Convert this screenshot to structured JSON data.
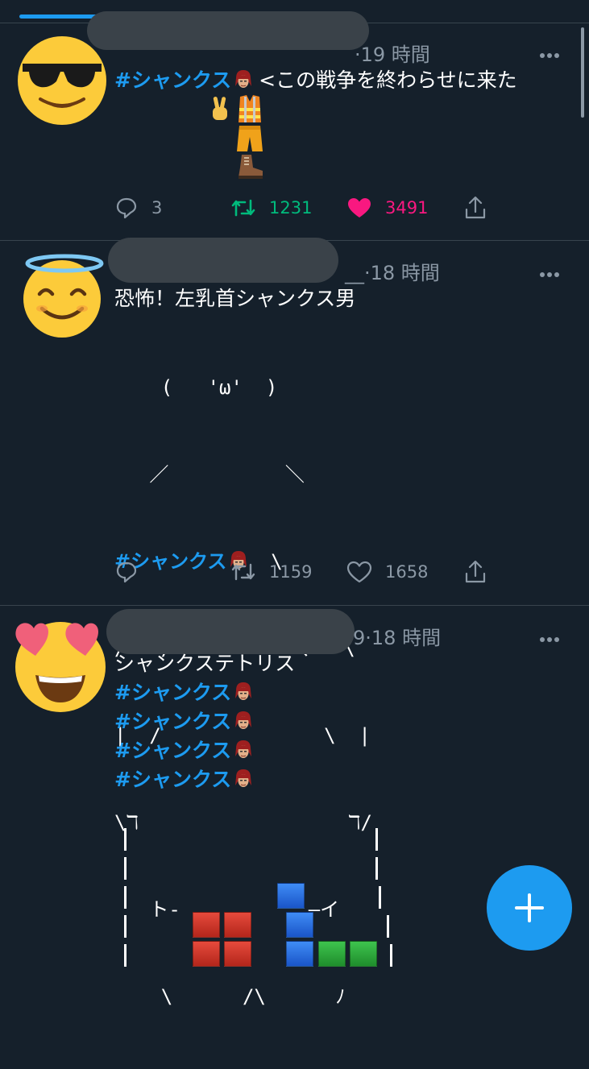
{
  "colors": {
    "background": "#15202b",
    "accent": "#1d9bf0",
    "retweet_active": "#00ba7c",
    "like_active": "#f91880",
    "muted": "#8b98a5"
  },
  "tweets": [
    {
      "time": "·19 時間",
      "tag": "#シャンクス",
      "text_after_tag": " <この戦争を終わらせに来た",
      "emoji_lines": [
        "✌️",
        "🦺",
        "🩳",
        "🥾"
      ],
      "replies": "3",
      "retweets": "1231",
      "likes": "3491",
      "retweeted": true,
      "liked": true,
      "avatar_icon": "sunglasses-face-icon"
    },
    {
      "time": "__·18 時間",
      "text": "恐怖！左乳首シャンクス男",
      "art": [
        "    (   'ω'  )",
        "   ／          ＼",
        "",
        "/   /           、  \\",
        "|  /              \\  |",
        "\\ℸ                  ℸ/",
        "   ト-           ―イ",
        "    \\      /\\      ﾉ"
      ],
      "art_tag": "#シャンクス",
      "art_tag_suffix": "  \\",
      "replies": "",
      "retweets": "1159",
      "likes": "1658",
      "retweeted": false,
      "liked": false,
      "avatar_icon": "halo-smiling-face-icon"
    },
    {
      "time": "9·18 時間",
      "text": "シャンクステトリス",
      "tag_lines": [
        "#シャンクス",
        "#シャンクス",
        "#シャンクス",
        "#シャンクス"
      ],
      "avatar_icon": "heart-eyes-face-icon"
    }
  ]
}
